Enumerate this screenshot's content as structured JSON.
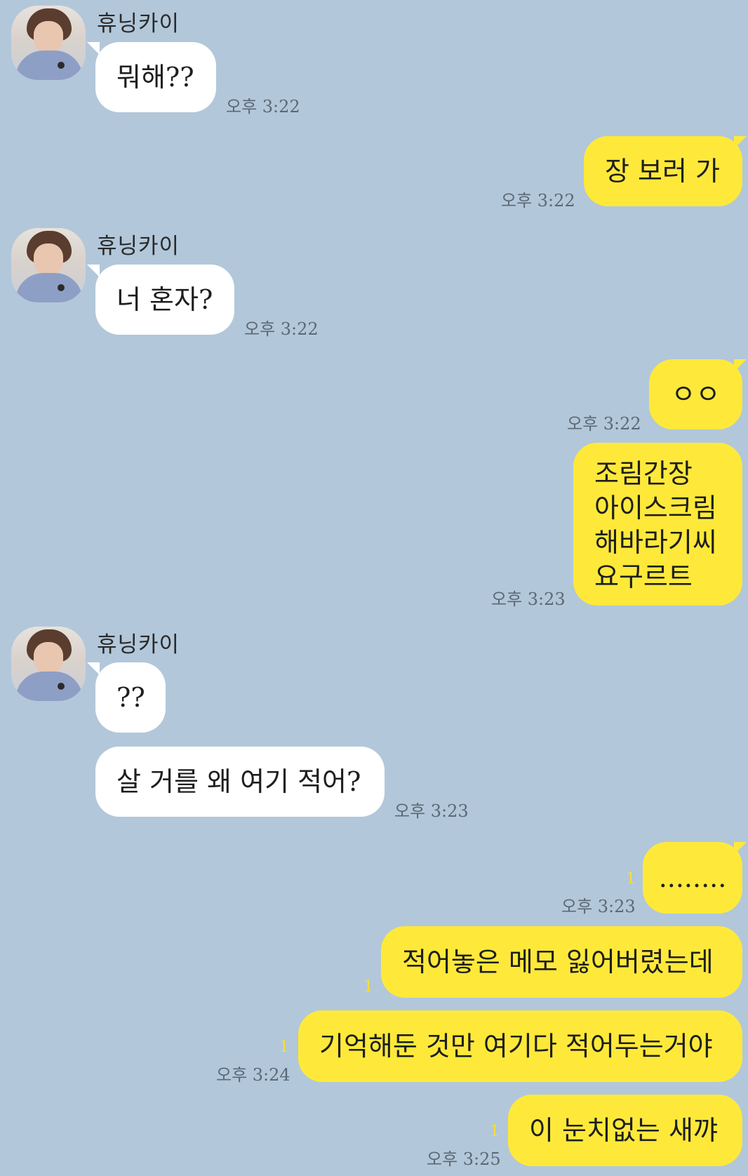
{
  "chat": {
    "contact_name": "휴닝카이",
    "messages": [
      {
        "side": "left",
        "text": "뭐해??",
        "time": "오후 3:22"
      },
      {
        "side": "right",
        "text": "장 보러 가",
        "time": "오후 3:22"
      },
      {
        "side": "left",
        "text": "너 혼자?",
        "time": "오후 3:22"
      },
      {
        "side": "right",
        "text": "ㅇㅇ",
        "time": "오후 3:22"
      },
      {
        "side": "right",
        "lines": [
          "조림간장",
          "아이스크림",
          "해바라기씨",
          "요구르트"
        ],
        "time": "오후 3:23"
      },
      {
        "side": "left",
        "text": "??"
      },
      {
        "side": "left",
        "text": "살 거를 왜 여기 적어?",
        "time": "오후 3:23"
      },
      {
        "side": "right",
        "text": "........",
        "unread": "1",
        "time": "오후 3:23"
      },
      {
        "side": "right",
        "text": "적어놓은 메모 잃어버렸는데",
        "unread": "1"
      },
      {
        "side": "right",
        "text": "기억해둔 것만 여기다 적어두는거야",
        "unread": "1",
        "time": "오후 3:24"
      },
      {
        "side": "right",
        "text": "이 눈치없는 새꺄",
        "unread": "1",
        "time": "오후 3:25"
      }
    ]
  },
  "colors": {
    "background": "#b2c7da",
    "my_bubble": "#fee93a",
    "their_bubble": "#ffffff",
    "unread": "#f4de3a"
  }
}
